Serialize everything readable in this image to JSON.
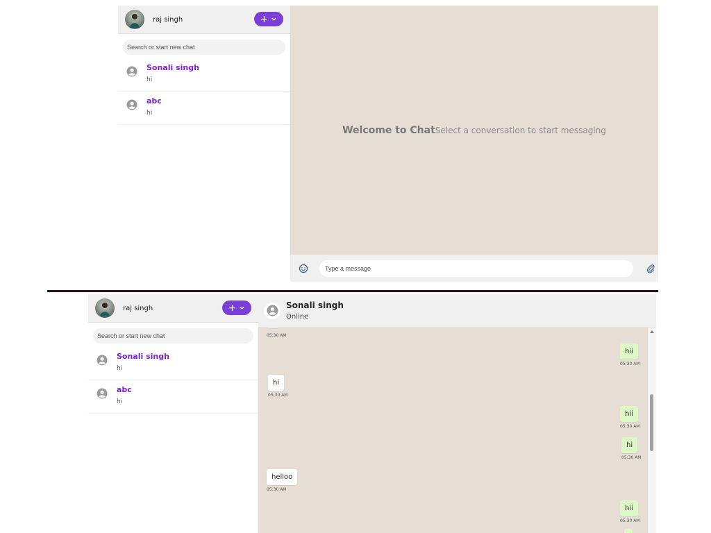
{
  "user": {
    "name": "raj singh"
  },
  "new_chat_button": {
    "label": "+"
  },
  "search": {
    "placeholder": "Search or start new chat"
  },
  "chats": [
    {
      "name": "Sonali singh",
      "last_message": "hi"
    },
    {
      "name": "abc",
      "last_message": "hi"
    }
  ],
  "welcome": {
    "title": "Welcome to Chat",
    "subtitle": "Select a conversation to start messaging"
  },
  "composer": {
    "placeholder": "Type a message"
  },
  "conversation": {
    "contact_name": "Sonali singh",
    "status": "Online",
    "messages": [
      {
        "text": "",
        "time": "05:30 AM",
        "direction": "received"
      },
      {
        "text": "hii",
        "time": "05:30 AM",
        "direction": "sent"
      },
      {
        "text": "hi",
        "time": "05:30 AM",
        "direction": "received"
      },
      {
        "text": "hii",
        "time": "05:30 AM",
        "direction": "sent"
      },
      {
        "text": "hi",
        "time": "05:30 AM",
        "direction": "sent"
      },
      {
        "text": "helloo",
        "time": "05:30 AM",
        "direction": "received"
      },
      {
        "text": "hii",
        "time": "05:30 AM",
        "direction": "sent"
      }
    ]
  },
  "colors": {
    "accent": "#7a3fd6",
    "contact_name": "#7a1fd8",
    "chat_background": "#e6ded5",
    "sent_bubble": "#dcf8c6",
    "received_bubble": "#ffffff"
  },
  "icons": {
    "avatar": "user-photo-avatar",
    "contact": "person-circle-icon",
    "emoji": "smiley-icon",
    "attach": "paperclip-icon",
    "dropdown": "chevron-down-icon"
  }
}
